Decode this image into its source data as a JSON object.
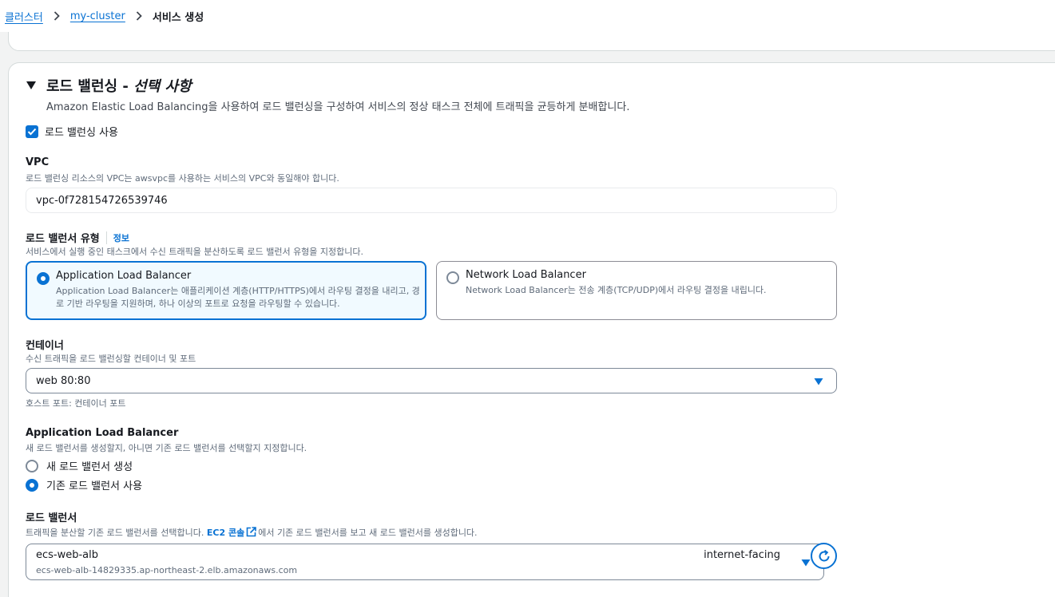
{
  "breadcrumb": {
    "items": [
      "클러스터",
      "my-cluster"
    ],
    "current": "서비스 생성"
  },
  "section": {
    "title": "로드 밸런싱 - ",
    "title_optional": "선택 사항",
    "description": "Amazon Elastic Load Balancing을 사용하여 로드 밸런싱을 구성하여 서비스의 정상 태스크 전체에 트래픽을 균등하게 분배합니다.",
    "use_lb_label": "로드 밸런싱 사용",
    "use_lb_checked": true
  },
  "vpc": {
    "label": "VPC",
    "description": "로드 밸런싱 리소스의 VPC는 awsvpc를 사용하는 서비스의 VPC와 동일해야 합니다.",
    "value": "vpc-0f728154726539746"
  },
  "lb_type": {
    "label": "로드 밸런서 유형",
    "info": "정보",
    "description": "서비스에서 실행 중인 태스크에서 수신 트래픽을 분산하도록 로드 밸런서 유형을 지정합니다.",
    "options": [
      {
        "title": "Application Load Balancer",
        "desc": "Application Load Balancer는 애플리케이션 계층(HTTP/HTTPS)에서 라우팅 결정을 내리고, 경로 기반 라우팅을 지원하며, 하나 이상의 포트로 요청을 라우팅할 수 있습니다.",
        "selected": true
      },
      {
        "title": "Network Load Balancer",
        "desc": "Network Load Balancer는 전송 계층(TCP/UDP)에서 라우팅 결정을 내립니다.",
        "selected": false
      }
    ]
  },
  "container": {
    "label": "컨테이너",
    "description": "수신 트래픽을 로드 밸런싱할 컨테이너 및 포트",
    "value": "web 80:80",
    "hint": "호스트 포트: 컨테이너 포트"
  },
  "alb": {
    "label": "Application Load Balancer",
    "description": "새 로드 밸런서를 생성할지, 아니면 기존 로드 밸런서를 선택할지 지정합니다.",
    "options": [
      "새 로드 밸런서 생성",
      "기존 로드 밸런서 사용"
    ],
    "selected_index": 1
  },
  "load_balancer": {
    "label": "로드 밸런서",
    "description_before": "트래픽을 분산할 기존 로드 밸런서를 선택합니다.",
    "link_text": "EC2 콘솔",
    "description_after": "에서 기존 로드 밸런서를 보고 새 로드 밸런서를 생성합니다.",
    "name": "ecs-web-alb",
    "dns": "ecs-web-alb-14829335.ap-northeast-2.elb.amazonaws.com",
    "scheme": "internet-facing"
  },
  "colors": {
    "accent": "#0972d3",
    "selected_tile_bg": "#f1faff"
  }
}
